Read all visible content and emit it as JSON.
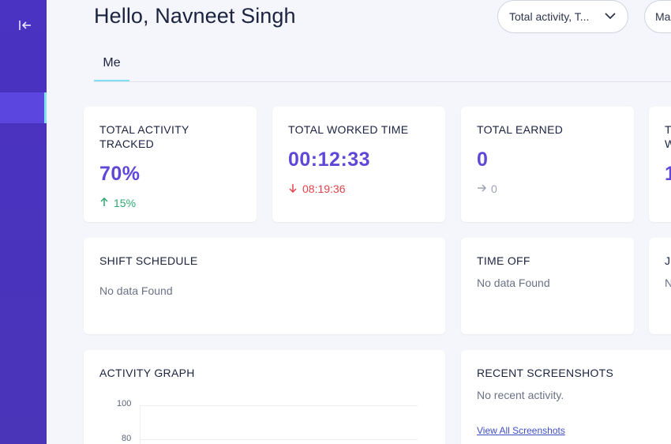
{
  "sidebar": {
    "collapse_icon": "collapse-left-icon"
  },
  "header": {
    "greeting": "Hello, Navneet Singh",
    "filter_label": "Total activity, T...",
    "filter2_label": "Ma"
  },
  "tabs": [
    {
      "label": "Me"
    }
  ],
  "stats": [
    {
      "title": "TOTAL ACTIVITY TRACKED",
      "value": "70%",
      "delta": "15%",
      "direction": "up"
    },
    {
      "title": "TOTAL WORKED TIME",
      "value": "00:12:33",
      "delta": "08:19:36",
      "direction": "down"
    },
    {
      "title": "TOTAL EARNED",
      "value": "0",
      "delta": "0",
      "direction": "flat"
    },
    {
      "title": "T W",
      "value": "1",
      "delta": "",
      "direction": "flat"
    }
  ],
  "shift_schedule": {
    "title": "SHIFT SCHEDULE",
    "empty": "No data Found"
  },
  "time_off": {
    "title": "TIME OFF",
    "empty": "No data Found"
  },
  "partial_card": {
    "title": "J",
    "empty": "N"
  },
  "activity_graph": {
    "title": "ACTIVITY GRAPH",
    "y_ticks": [
      "100",
      "80"
    ]
  },
  "recent_screenshots": {
    "title": "RECENT SCREENSHOTS",
    "empty": "No recent activity.",
    "link": "View All Screenshots"
  },
  "colors": {
    "sidebar": "#4a32c2",
    "accent": "#5f48d8",
    "tab_underline": "#7fe0f2",
    "up": "#2ba870",
    "down": "#e0434b"
  }
}
